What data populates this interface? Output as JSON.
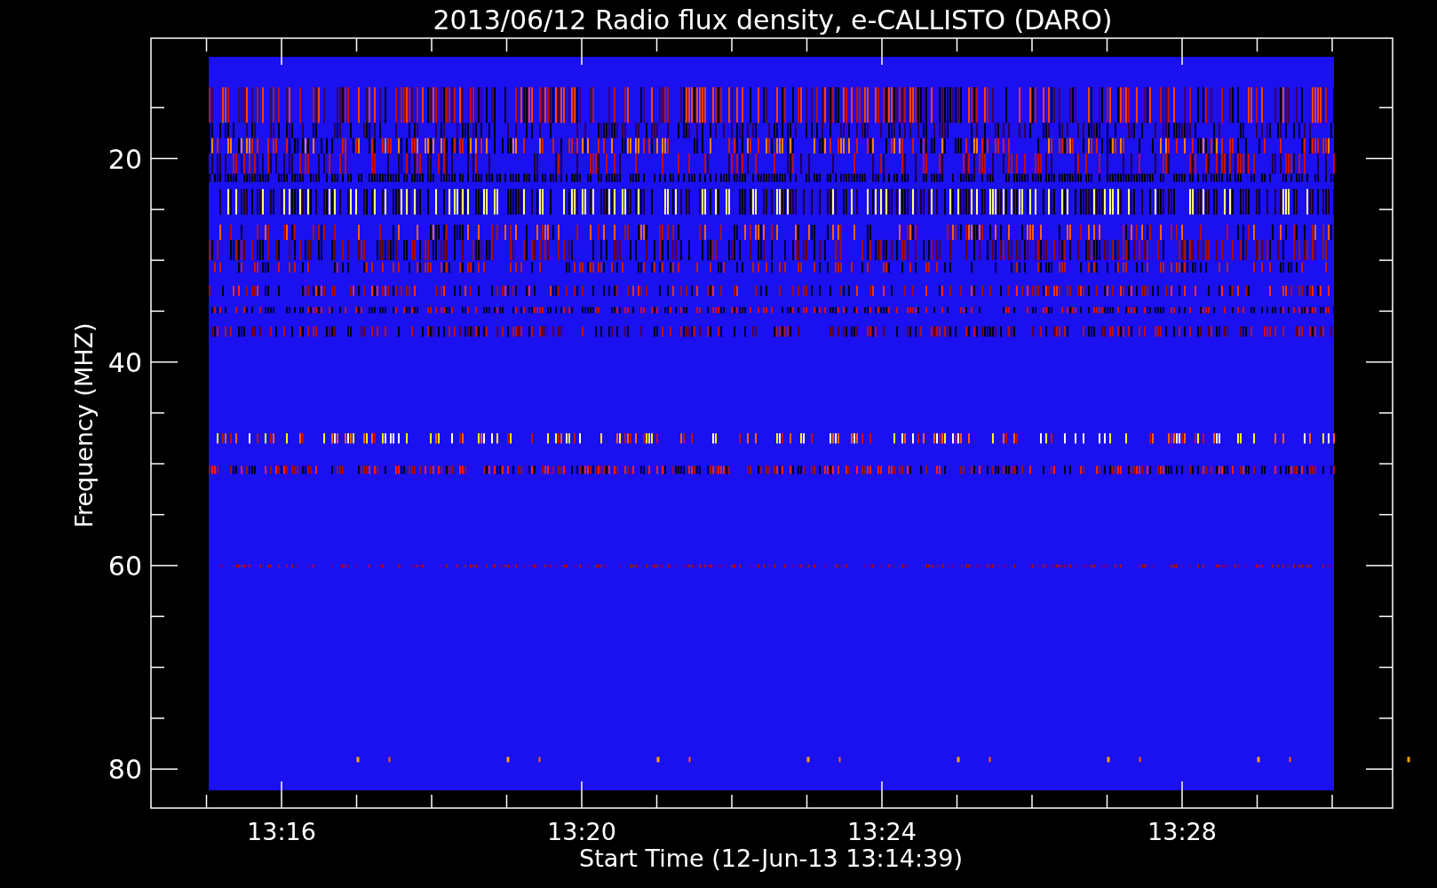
{
  "title": "2013/06/12  Radio flux density, e-CALLISTO (DARO)",
  "y_axis": {
    "label": "Frequency (MHZ)",
    "ticks": [
      "20",
      "40",
      "60",
      "80"
    ]
  },
  "x_axis": {
    "label": "Start Time (12-Jun-13 13:14:39)",
    "ticks": [
      "13:16",
      "13:20",
      "13:24",
      "13:28"
    ]
  }
}
